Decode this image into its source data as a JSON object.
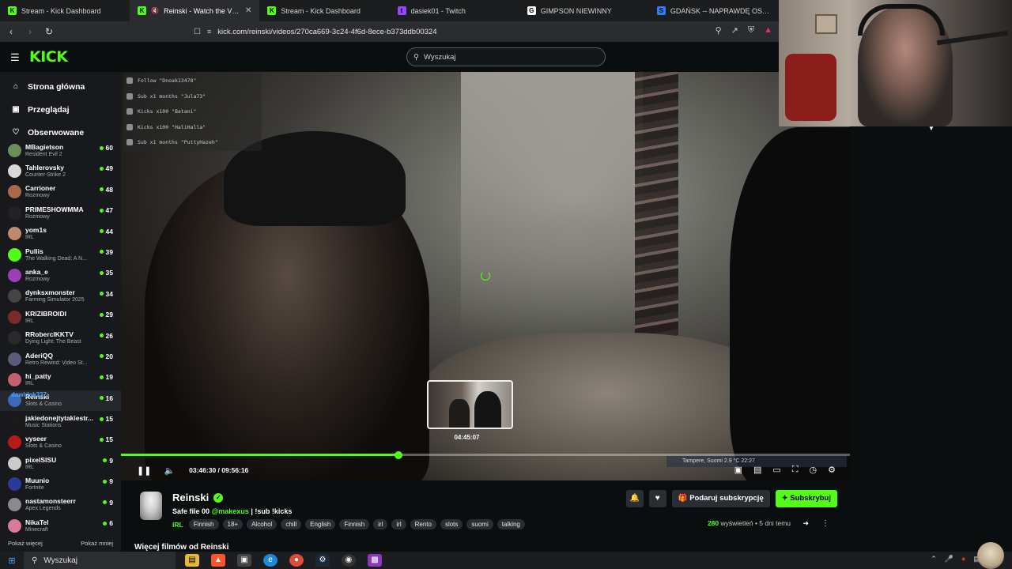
{
  "browser": {
    "tabs": [
      {
        "title": "Stream - Kick Dashboard",
        "icon": "kick-icon",
        "active": false
      },
      {
        "title": "Reinski - Watch the VOD on Kick",
        "icon": "kick-icon",
        "active": true
      },
      {
        "title": "Stream - Kick Dashboard",
        "icon": "kick-icon",
        "active": false
      },
      {
        "title": "dasiek01 - Twitch",
        "icon": "twitch-icon",
        "active": false
      },
      {
        "title": "GIMPSON NIEWINNY",
        "icon": "google-icon",
        "active": false
      },
      {
        "title": "GDAŃSK -- NAPRAWDĘ OSTATNIA T",
        "icon": "s-icon",
        "active": false
      }
    ],
    "url": "kick.com/reinski/videos/270ca669-3c24-4f6d-8ece-b373ddb00324"
  },
  "header": {
    "logo": "KICK",
    "search_placeholder": "Wyszukaj"
  },
  "sidebar": {
    "nav": [
      {
        "label": "Strona główna",
        "icon": "home-icon"
      },
      {
        "label": "Przeglądaj",
        "icon": "browse-icon"
      },
      {
        "label": "Obserwowane",
        "icon": "heart-icon"
      }
    ],
    "followed": [
      {
        "name": "MBagietson",
        "game": "Resident Evil 2",
        "viewers": "60",
        "color": "#6b8e5a"
      },
      {
        "name": "Tahlerovsky",
        "game": "Counter-Strike 2",
        "viewers": "49",
        "color": "#d9d9d9"
      },
      {
        "name": "Carrioner",
        "game": "Rozmowy",
        "viewers": "48",
        "color": "#a86a4a"
      },
      {
        "name": "PRIMESHOWMMA",
        "game": "Rozmowy",
        "viewers": "47",
        "color": "#222222"
      },
      {
        "name": "yom1s",
        "game": "IRL",
        "viewers": "44",
        "color": "#c08a6a"
      },
      {
        "name": "Pullis",
        "game": "The Walking Dead: A N...",
        "viewers": "39",
        "color": "#53fc18"
      },
      {
        "name": "anka_e",
        "game": "Rozmowy",
        "viewers": "35",
        "color": "#9b3fb8"
      },
      {
        "name": "dynksxmonster",
        "game": "Farming Simulator 2025",
        "viewers": "34",
        "color": "#444444"
      },
      {
        "name": "KRIZIBROIDI",
        "game": "IRL",
        "viewers": "29",
        "color": "#7a2a2a"
      },
      {
        "name": "RRobercIKKTV",
        "game": "Dying Light: The Beast",
        "viewers": "26",
        "color": "#2a2a2a"
      },
      {
        "name": "AderiQQ",
        "game": "Retro Rewind: Video St...",
        "viewers": "20",
        "color": "#5a5a7a"
      },
      {
        "name": "hi_patty",
        "game": "IRL",
        "viewers": "19",
        "color": "#c06070"
      },
      {
        "name": "Reinski",
        "game": "Slots & Casino",
        "viewers": "16",
        "color": "#3a6ab8"
      },
      {
        "name": "jakiedonejtytakiestr...",
        "game": "Music Stations",
        "viewers": "15",
        "color": "#1a1a1a"
      },
      {
        "name": "vyseer",
        "game": "Slots & Casino",
        "viewers": "15",
        "color": "#b81a1a"
      },
      {
        "name": "pixelSISU",
        "game": "IRL",
        "viewers": "9",
        "color": "#cccccc"
      },
      {
        "name": "Muunio",
        "game": "Fortnite",
        "viewers": "9",
        "color": "#2a3a9a"
      },
      {
        "name": "nastamonsteerr",
        "game": "Apex Legends",
        "viewers": "9",
        "color": "#8a8a8a"
      },
      {
        "name": "NikaTel",
        "game": "Minecraft",
        "viewers": "6",
        "color": "#d87a9a"
      }
    ],
    "show_more": "Pokaż więcej",
    "show_less": "Pokaż mniej",
    "chat_popup": "dawidek337:"
  },
  "video": {
    "chat_lines": [
      "Follow \"Dnoak13478\"",
      "Sub x1 months \"Jula73\"",
      "Kicks x100 \"Batani\"",
      "Kicks x100 \"HaliHalla\"",
      "Sub x1 months \"PuttyHazeh\""
    ],
    "weather_text": "Tampere, Suomi  2.9 °C   22:27",
    "preview_time": "04:45:07",
    "current_time": "03:46:30",
    "duration": "09:56:16",
    "time_display": "03:46:30 / 09:56:16",
    "progress_fraction": 0.381,
    "hover_fraction": 0.481
  },
  "stream_info": {
    "channel": "Reinski",
    "title_prefix": "Safe file 00 ",
    "title_mention": "@makexus",
    "title_suffix": " | !sub !kicks",
    "category": "IRL",
    "tags": [
      "Finnish",
      "18+",
      "Alcohol",
      "chill",
      "English",
      "Finnish",
      "irl",
      "irl",
      "Rento",
      "slots",
      "suomi",
      "talking"
    ],
    "gift_label": "Podaruj subskrypcję",
    "subscribe_label": "Subskrybuj",
    "views": "280",
    "views_label": " wyświetleń",
    "age": " • 5 dni temu",
    "more_videos": "Więcej filmów od Reinski"
  },
  "taskbar": {
    "search_label": "Wyszukaj"
  },
  "colors": {
    "accent": "#53fc18",
    "background": "#0b0e0f",
    "sidebar": "#17191c"
  }
}
